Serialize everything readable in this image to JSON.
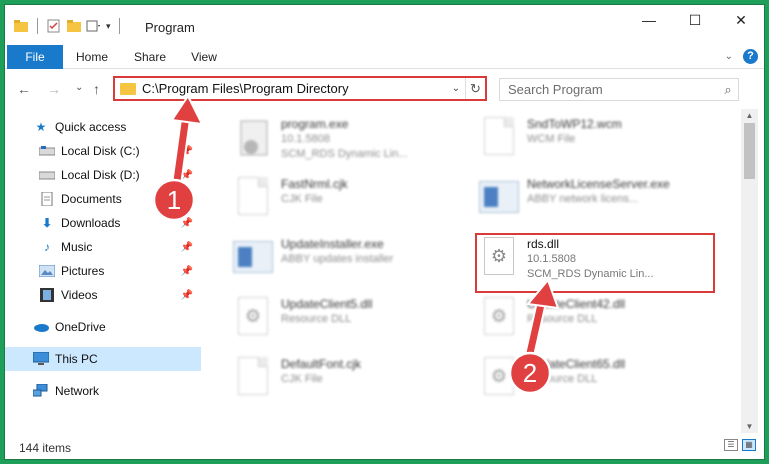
{
  "window": {
    "title": "Program",
    "controls": {
      "minimize": "—",
      "maximize": "☐",
      "close": "✕"
    }
  },
  "ribbon": {
    "tabs": [
      {
        "label": "File",
        "active": true
      },
      {
        "label": "Home"
      },
      {
        "label": "Share"
      },
      {
        "label": "View"
      }
    ],
    "help": "?"
  },
  "navigation": {
    "back": "←",
    "forward": "→",
    "recent": "⌄",
    "up": "↑",
    "address": "C:\\Program Files\\Program Directory",
    "search_placeholder": "Search Program"
  },
  "sidebar": {
    "items": [
      {
        "label": "Quick access",
        "icon": "star-icon",
        "pinned": false
      },
      {
        "label": "Local Disk (C:)",
        "icon": "drive-icon",
        "pinned": true
      },
      {
        "label": "Local Disk (D:)",
        "icon": "drive-icon",
        "pinned": true
      },
      {
        "label": "Documents",
        "icon": "documents-icon",
        "pinned": true
      },
      {
        "label": "Downloads",
        "icon": "download-icon",
        "pinned": true
      },
      {
        "label": "Music",
        "icon": "music-icon",
        "pinned": true
      },
      {
        "label": "Pictures",
        "icon": "pictures-icon",
        "pinned": true
      },
      {
        "label": "Videos",
        "icon": "videos-icon",
        "pinned": true
      },
      {
        "label": "OneDrive",
        "icon": "cloud-icon",
        "pinned": false
      },
      {
        "label": "This PC",
        "icon": "computer-icon",
        "pinned": false,
        "selected": true
      },
      {
        "label": "Network",
        "icon": "network-icon",
        "pinned": false
      }
    ]
  },
  "files": [
    {
      "name": "program.exe",
      "line2": "10.1.5808",
      "line3": "SCM_RDS Dynamic Lin...",
      "icon": "installer-icon"
    },
    {
      "name": "SndToWP12.wcm",
      "line2": "WCM File",
      "line3": "",
      "icon": "document-icon"
    },
    {
      "name": "FastNrml.cjk",
      "line2": "CJK File",
      "line3": "",
      "icon": "document-icon"
    },
    {
      "name": "NetworkLicenseServer.exe",
      "line2": "ABBY network licens...",
      "line3": "",
      "icon": "application-icon"
    },
    {
      "name": "UpdateInstaller.exe",
      "line2": "ABBY updates installer",
      "line3": "",
      "icon": "application-icon"
    },
    {
      "name": "rds.dll",
      "line2": "10.1.5808",
      "line3": "SCM_RDS Dynamic Lin...",
      "icon": "dll-gear-icon"
    },
    {
      "name": "UpdateClient5.dll",
      "line2": "Resource DLL",
      "line3": "",
      "icon": "dll-gear-icon"
    },
    {
      "name": "UpdateClient42.dll",
      "line2": "Resource DLL",
      "line3": "",
      "icon": "dll-gear-icon"
    },
    {
      "name": "DefaultFont.cjk",
      "line2": "CJK File",
      "line3": "",
      "icon": "document-icon"
    },
    {
      "name": "UpdateClient65.dll",
      "line2": "Resource DLL",
      "line3": "",
      "icon": "dll-gear-icon"
    }
  ],
  "annotations": {
    "step1": "1",
    "step2": "2",
    "highlight_color": "#d93b3b"
  },
  "status": {
    "item_count": "144 items"
  }
}
